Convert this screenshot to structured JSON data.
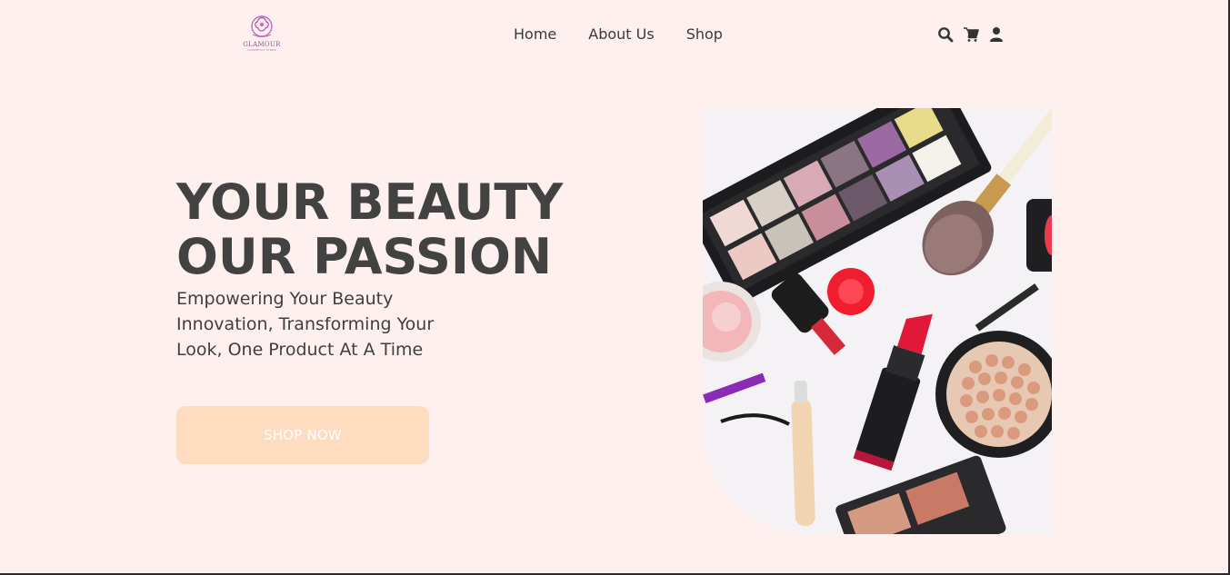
{
  "brand": {
    "name": "GLAMOUR",
    "tagline": "COSMETICS STORE"
  },
  "nav": {
    "items": [
      "Home",
      "About Us",
      "Shop"
    ]
  },
  "header_icons": [
    "search-icon",
    "cart-icon",
    "user-icon"
  ],
  "hero": {
    "title_line1": "YOUR BEAUTY",
    "title_line2": "OUR PASSION",
    "subtitle": "Empowering Your Beauty Innovation, Transforming Your Look, One Product At A Time",
    "cta_label": "SHOP NOW"
  },
  "colors": {
    "background": "#fff0f0",
    "heading": "#424242",
    "cta_background": "#fddcc0",
    "cta_text": "#ffffff",
    "logo_accent": "#c36bc0"
  }
}
